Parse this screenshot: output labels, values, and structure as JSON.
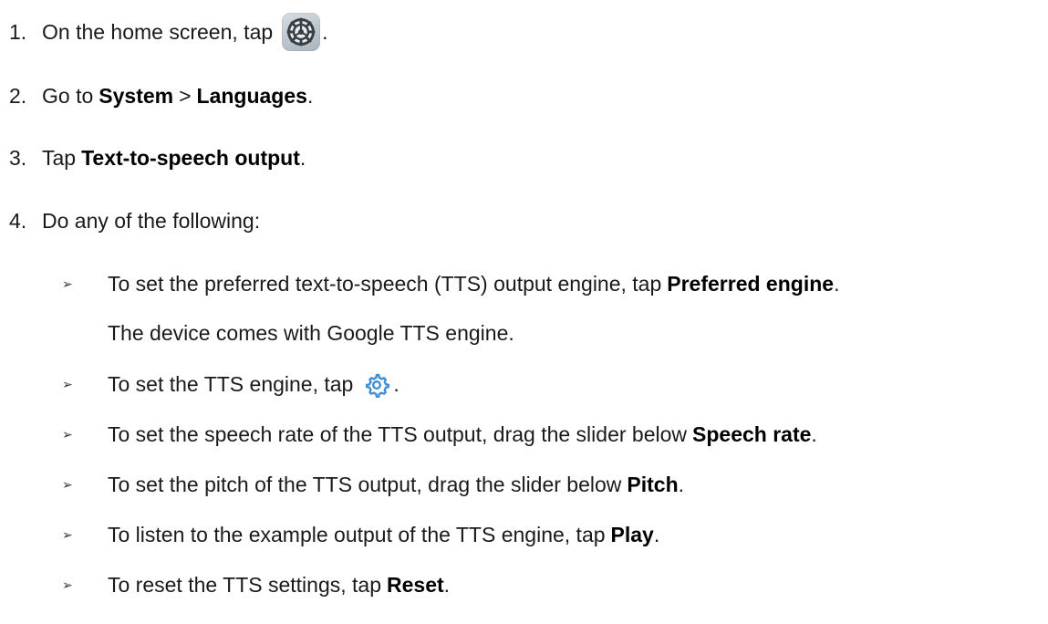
{
  "steps": [
    {
      "num": "1.",
      "pre": "On the home screen, tap",
      "post": "."
    },
    {
      "num": "2.",
      "pre": "Go to ",
      "b1": "System",
      "mid": " > ",
      "b2": "Languages",
      "post": "."
    },
    {
      "num": "3.",
      "pre": "Tap ",
      "b1": "Text-to-speech output",
      "post": "."
    },
    {
      "num": "4.",
      "pre": "Do any of the following:"
    }
  ],
  "bullets": [
    {
      "glyph": "➢",
      "pre": "To set the preferred text-to-speech (TTS) output engine, tap ",
      "b": "Preferred engine",
      "post": "."
    },
    {
      "cont": "The device comes with Google TTS engine."
    },
    {
      "glyph": "➢",
      "pre": "To set the TTS engine, tap",
      "post": "."
    },
    {
      "glyph": "➢",
      "pre": "To set the speech rate of the TTS output, drag the slider below ",
      "b": "Speech rate",
      "post": "."
    },
    {
      "glyph": "➢",
      "pre": "To set the pitch of the TTS output, drag the slider below ",
      "b": "Pitch",
      "post": "."
    },
    {
      "glyph": "➢",
      "pre": "To listen to the example output of the TTS engine, tap ",
      "b": "Play",
      "post": "."
    },
    {
      "glyph": "➢",
      "pre": "To reset the TTS settings, tap ",
      "b": "Reset",
      "post": "."
    }
  ],
  "icons": {
    "settings_app": "settings-app-icon",
    "gear": "gear-icon",
    "gear_color": "#3d8fd8"
  }
}
